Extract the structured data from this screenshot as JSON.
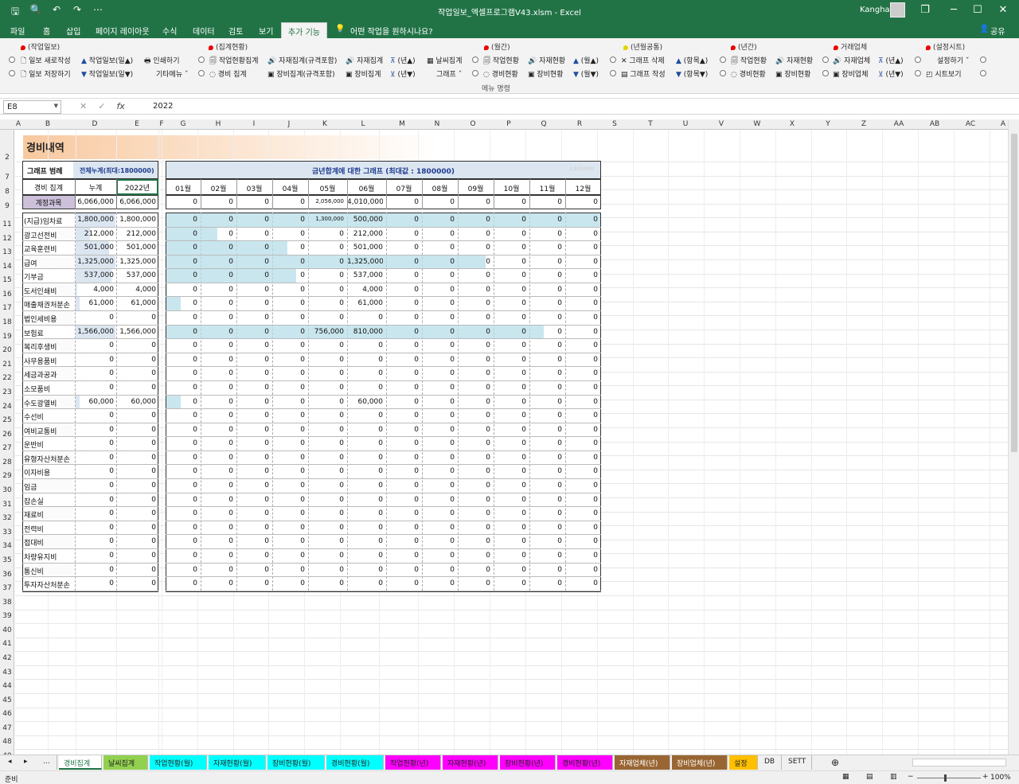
{
  "title": {
    "window": "작업일보_엑셀프로그램V43.xlsm  -  Excel",
    "user": "Kangha",
    "minimize": "─",
    "restore": "❐",
    "maximize": "☐",
    "close": "✕",
    "save_glyph": "🖫",
    "preview_glyph": "🔍",
    "undo_glyph": "↶",
    "redo_glyph": "↷",
    "more_glyph": "⋯"
  },
  "menu": {
    "tabs": [
      "파일",
      "홈",
      "삽입",
      "페이지 레이아웃",
      "수식",
      "데이터",
      "검토",
      "보기",
      "추가 기능"
    ],
    "tell": "어떤 작업을 원하시나요?",
    "share": "공유"
  },
  "ribbon": {
    "groups": [
      "(작업일보)",
      "(집계현황)",
      "(월간)",
      "(년월공통)",
      "(년간)",
      "거래업체",
      "(설정시트)"
    ],
    "buttons": [
      [
        "일보 새로작성",
        "작업일보(일▲)",
        "인쇄하기",
        "작업현황집계",
        "자재집계(규격포함)",
        "자재집계",
        "(년▲)",
        "날씨집계",
        "작업현황",
        "자재현황",
        "(월▲)",
        "그래프 삭제",
        "(항목▲)",
        "작업현황",
        "자재현황",
        "자재업체",
        "(년▲)",
        "설정하기 ˇ"
      ],
      [
        "일보 저장하기",
        "작업일보(일▼)",
        "기타메뉴 ˇ",
        "경비 집계",
        "장비집계(규격포함)",
        "장비집계",
        "(년▼)",
        "그래프 ˇ",
        "경비현황",
        "장비현황",
        "(월▼)",
        "그래프 작성",
        "(항목▼)",
        "경비현황",
        "장비현황",
        "장비업체",
        "(년▼)",
        "시트보기"
      ]
    ],
    "footer": "메뉴 명령"
  },
  "formula": {
    "namebox": "E8",
    "value": "2022",
    "cancel": "✕",
    "enter": "✓",
    "fx": "fx"
  },
  "columns": [
    "A",
    "B",
    "D",
    "E",
    "F",
    "G",
    "H",
    "I",
    "J",
    "K",
    "L",
    "M",
    "N",
    "O",
    "P",
    "Q",
    "R",
    "S",
    "T",
    "U",
    "V",
    "W",
    "X",
    "Y",
    "Z",
    "AA",
    "AB",
    "AC",
    "A"
  ],
  "rows": [
    "2",
    "7",
    "8",
    "9",
    "11",
    "12",
    "13",
    "14",
    "15",
    "16",
    "17",
    "18",
    "19",
    "20",
    "21",
    "22",
    "23",
    "24",
    "25",
    "26",
    "27",
    "28",
    "29",
    "30",
    "31",
    "32",
    "33",
    "34",
    "35",
    "36",
    "37",
    "38",
    "39",
    "40",
    "41",
    "42",
    "43",
    "44",
    "45",
    "46",
    "47",
    "48",
    "49"
  ],
  "sheet": {
    "title": "경비내역",
    "legend_label": "그래프 범례",
    "legend_value": "전체누계(최대:1800000)",
    "chart_title": "금년합계에 대한 그래프 (최대값 : 1800000)",
    "chart_faint": "1,800,000",
    "hdr_item": "경비 집계",
    "hdr_total": "누계",
    "hdr_year": "2022년",
    "months": [
      "01월",
      "02월",
      "03월",
      "04월",
      "05월",
      "06월",
      "07월",
      "08월",
      "09월",
      "10월",
      "11월",
      "12월"
    ],
    "sum_label": "계정과목",
    "sum_total": "6,066,000",
    "sum_year": "6,066,000",
    "sum_months": [
      "0",
      "0",
      "0",
      "0",
      "2,056,000",
      "4,010,000",
      "0",
      "0",
      "0",
      "0",
      "0",
      "0"
    ],
    "items": [
      {
        "name": "(지급)임차료",
        "total": "1,800,000",
        "year": "1,800,000",
        "months": [
          "0",
          "0",
          "0",
          "0",
          "1,300,000",
          "500,000",
          "0",
          "0",
          "0",
          "0",
          "0",
          "0"
        ]
      },
      {
        "name": "광고선전비",
        "total": "212,000",
        "year": "212,000",
        "months": [
          "0",
          "0",
          "0",
          "0",
          "0",
          "212,000",
          "0",
          "0",
          "0",
          "0",
          "0",
          "0"
        ]
      },
      {
        "name": "교육훈련비",
        "total": "501,000",
        "year": "501,000",
        "months": [
          "0",
          "0",
          "0",
          "0",
          "0",
          "501,000",
          "0",
          "0",
          "0",
          "0",
          "0",
          "0"
        ]
      },
      {
        "name": "급여",
        "total": "1,325,000",
        "year": "1,325,000",
        "months": [
          "0",
          "0",
          "0",
          "0",
          "0",
          "1,325,000",
          "0",
          "0",
          "0",
          "0",
          "0",
          "0"
        ]
      },
      {
        "name": "기부금",
        "total": "537,000",
        "year": "537,000",
        "months": [
          "0",
          "0",
          "0",
          "0",
          "0",
          "537,000",
          "0",
          "0",
          "0",
          "0",
          "0",
          "0"
        ]
      },
      {
        "name": "도서인쇄비",
        "total": "4,000",
        "year": "4,000",
        "months": [
          "0",
          "0",
          "0",
          "0",
          "0",
          "4,000",
          "0",
          "0",
          "0",
          "0",
          "0",
          "0"
        ]
      },
      {
        "name": "매출채권처분손",
        "total": "61,000",
        "year": "61,000",
        "months": [
          "0",
          "0",
          "0",
          "0",
          "0",
          "61,000",
          "0",
          "0",
          "0",
          "0",
          "0",
          "0"
        ]
      },
      {
        "name": "법인세비용",
        "total": "0",
        "year": "0",
        "months": [
          "0",
          "0",
          "0",
          "0",
          "0",
          "0",
          "0",
          "0",
          "0",
          "0",
          "0",
          "0"
        ]
      },
      {
        "name": "보험료",
        "total": "1,566,000",
        "year": "1,566,000",
        "months": [
          "0",
          "0",
          "0",
          "0",
          "756,000",
          "810,000",
          "0",
          "0",
          "0",
          "0",
          "0",
          "0"
        ]
      },
      {
        "name": "복리후생비",
        "total": "0",
        "year": "0",
        "months": [
          "0",
          "0",
          "0",
          "0",
          "0",
          "0",
          "0",
          "0",
          "0",
          "0",
          "0",
          "0"
        ]
      },
      {
        "name": "사무용품비",
        "total": "0",
        "year": "0",
        "months": [
          "0",
          "0",
          "0",
          "0",
          "0",
          "0",
          "0",
          "0",
          "0",
          "0",
          "0",
          "0"
        ]
      },
      {
        "name": "세금과공과",
        "total": "0",
        "year": "0",
        "months": [
          "0",
          "0",
          "0",
          "0",
          "0",
          "0",
          "0",
          "0",
          "0",
          "0",
          "0",
          "0"
        ]
      },
      {
        "name": "소모품비",
        "total": "0",
        "year": "0",
        "months": [
          "0",
          "0",
          "0",
          "0",
          "0",
          "0",
          "0",
          "0",
          "0",
          "0",
          "0",
          "0"
        ]
      },
      {
        "name": "수도광열비",
        "total": "60,000",
        "year": "60,000",
        "months": [
          "0",
          "0",
          "0",
          "0",
          "0",
          "60,000",
          "0",
          "0",
          "0",
          "0",
          "0",
          "0"
        ]
      },
      {
        "name": "수선비",
        "total": "0",
        "year": "0",
        "months": [
          "0",
          "0",
          "0",
          "0",
          "0",
          "0",
          "0",
          "0",
          "0",
          "0",
          "0",
          "0"
        ]
      },
      {
        "name": "여비교통비",
        "total": "0",
        "year": "0",
        "months": [
          "0",
          "0",
          "0",
          "0",
          "0",
          "0",
          "0",
          "0",
          "0",
          "0",
          "0",
          "0"
        ]
      },
      {
        "name": "운반비",
        "total": "0",
        "year": "0",
        "months": [
          "0",
          "0",
          "0",
          "0",
          "0",
          "0",
          "0",
          "0",
          "0",
          "0",
          "0",
          "0"
        ]
      },
      {
        "name": "유형자산처분손",
        "total": "0",
        "year": "0",
        "months": [
          "0",
          "0",
          "0",
          "0",
          "0",
          "0",
          "0",
          "0",
          "0",
          "0",
          "0",
          "0"
        ]
      },
      {
        "name": "이자비용",
        "total": "0",
        "year": "0",
        "months": [
          "0",
          "0",
          "0",
          "0",
          "0",
          "0",
          "0",
          "0",
          "0",
          "0",
          "0",
          "0"
        ]
      },
      {
        "name": "임금",
        "total": "0",
        "year": "0",
        "months": [
          "0",
          "0",
          "0",
          "0",
          "0",
          "0",
          "0",
          "0",
          "0",
          "0",
          "0",
          "0"
        ]
      },
      {
        "name": "잡손실",
        "total": "0",
        "year": "0",
        "months": [
          "0",
          "0",
          "0",
          "0",
          "0",
          "0",
          "0",
          "0",
          "0",
          "0",
          "0",
          "0"
        ]
      },
      {
        "name": "재료비",
        "total": "0",
        "year": "0",
        "months": [
          "0",
          "0",
          "0",
          "0",
          "0",
          "0",
          "0",
          "0",
          "0",
          "0",
          "0",
          "0"
        ]
      },
      {
        "name": "전력비",
        "total": "0",
        "year": "0",
        "months": [
          "0",
          "0",
          "0",
          "0",
          "0",
          "0",
          "0",
          "0",
          "0",
          "0",
          "0",
          "0"
        ]
      },
      {
        "name": "접대비",
        "total": "0",
        "year": "0",
        "months": [
          "0",
          "0",
          "0",
          "0",
          "0",
          "0",
          "0",
          "0",
          "0",
          "0",
          "0",
          "0"
        ]
      },
      {
        "name": "차량유지비",
        "total": "0",
        "year": "0",
        "months": [
          "0",
          "0",
          "0",
          "0",
          "0",
          "0",
          "0",
          "0",
          "0",
          "0",
          "0",
          "0"
        ]
      },
      {
        "name": "통신비",
        "total": "0",
        "year": "0",
        "months": [
          "0",
          "0",
          "0",
          "0",
          "0",
          "0",
          "0",
          "0",
          "0",
          "0",
          "0",
          "0"
        ]
      },
      {
        "name": "투자자산처분손",
        "total": "0",
        "year": "0",
        "months": [
          "0",
          "0",
          "0",
          "0",
          "0",
          "0",
          "0",
          "0",
          "0",
          "0",
          "0",
          "0"
        ]
      }
    ]
  },
  "bar_max": 1800000,
  "bar_values": [
    1800000,
    212000,
    501000,
    1325000,
    537000,
    4000,
    61000,
    0,
    1566000,
    0,
    0,
    0,
    0,
    60000,
    0,
    0,
    0,
    0,
    0,
    0,
    0,
    0,
    0,
    0,
    0,
    0,
    0
  ],
  "sheet_tabs": [
    {
      "label": "...",
      "color": "#f0f0f0"
    },
    {
      "label": "경비집계",
      "color": "#ffffff"
    },
    {
      "label": "날씨집계",
      "color": "#92d050"
    },
    {
      "label": "작업현황(월)",
      "color": "#00ffff"
    },
    {
      "label": "자재현황(월)",
      "color": "#00ffff"
    },
    {
      "label": "장비현황(월)",
      "color": "#00ffff"
    },
    {
      "label": "경비현황(월)",
      "color": "#00ffff"
    },
    {
      "label": "작업현황(년)",
      "color": "#ff00ff"
    },
    {
      "label": "자재현황(년)",
      "color": "#ff00ff"
    },
    {
      "label": "장비현황(년)",
      "color": "#ff00ff"
    },
    {
      "label": "경비현황(년)",
      "color": "#ff00ff"
    },
    {
      "label": "자재업체(년)",
      "color": "#996633"
    },
    {
      "label": "장비업체(년)",
      "color": "#996633"
    },
    {
      "label": "설정",
      "color": "#ffc000"
    },
    {
      "label": "DB",
      "color": "#f0f0f0"
    },
    {
      "label": "SETT",
      "color": "#f0f0f0"
    }
  ],
  "status": {
    "ready": "준비",
    "zoom": "100%",
    "add_sheet": "⊕",
    "prev": "◂",
    "next": "▸",
    "minus": "−",
    "plus": "+"
  }
}
